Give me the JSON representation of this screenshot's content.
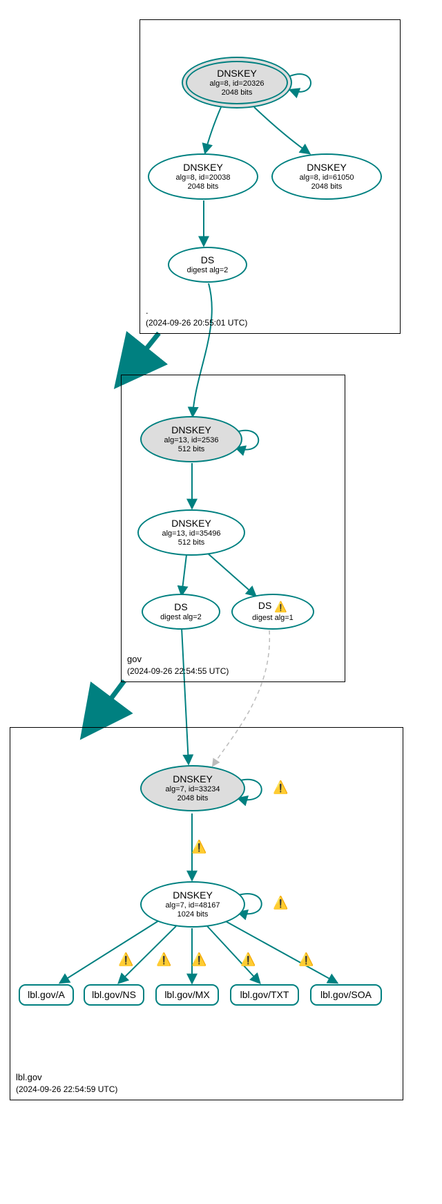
{
  "chart_data": {
    "type": "diagram",
    "diagram_type": "dnssec-chain-of-trust",
    "zones": [
      {
        "name": ".",
        "timestamp": "(2024-09-26 20:55:01 UTC)",
        "nodes": [
          {
            "id": "root-ksk",
            "kind": "DNSKEY",
            "alg": "alg=8, id=20326",
            "bits": "2048 bits",
            "shape": "ellipse",
            "grey": true,
            "double": true
          },
          {
            "id": "root-zsk",
            "kind": "DNSKEY",
            "alg": "alg=8, id=20038",
            "bits": "2048 bits",
            "shape": "ellipse",
            "grey": false,
            "double": false
          },
          {
            "id": "root-dnskey3",
            "kind": "DNSKEY",
            "alg": "alg=8, id=61050",
            "bits": "2048 bits",
            "shape": "ellipse",
            "grey": false,
            "double": false
          },
          {
            "id": "root-ds",
            "kind": "DS",
            "alg": "digest alg=2",
            "bits": "",
            "shape": "ellipse",
            "grey": false,
            "double": false
          }
        ],
        "edges": [
          {
            "from": "root-ksk",
            "to": "root-ksk",
            "self": true
          },
          {
            "from": "root-ksk",
            "to": "root-zsk"
          },
          {
            "from": "root-ksk",
            "to": "root-dnskey3"
          },
          {
            "from": "root-zsk",
            "to": "root-ds"
          }
        ]
      },
      {
        "name": "gov",
        "timestamp": "(2024-09-26 22:54:55 UTC)",
        "nodes": [
          {
            "id": "gov-ksk",
            "kind": "DNSKEY",
            "alg": "alg=13, id=2536",
            "bits": "512 bits",
            "shape": "ellipse",
            "grey": true,
            "double": false
          },
          {
            "id": "gov-zsk",
            "kind": "DNSKEY",
            "alg": "alg=13, id=35496",
            "bits": "512 bits",
            "shape": "ellipse",
            "grey": false,
            "double": false
          },
          {
            "id": "gov-ds2",
            "kind": "DS",
            "alg": "digest alg=2",
            "bits": "",
            "shape": "ellipse",
            "grey": false,
            "double": false,
            "warn": false
          },
          {
            "id": "gov-ds1",
            "kind": "DS",
            "alg": "digest alg=1",
            "bits": "",
            "shape": "ellipse",
            "grey": false,
            "double": false,
            "warn": true
          }
        ],
        "edges": [
          {
            "from": "root-ds",
            "to": "gov-ksk"
          },
          {
            "from": "gov-ksk",
            "to": "gov-ksk",
            "self": true
          },
          {
            "from": "gov-ksk",
            "to": "gov-zsk"
          },
          {
            "from": "gov-zsk",
            "to": "gov-ds2"
          },
          {
            "from": "gov-zsk",
            "to": "gov-ds1"
          }
        ]
      },
      {
        "name": "lbl.gov",
        "timestamp": "(2024-09-26 22:54:59 UTC)",
        "nodes": [
          {
            "id": "lbl-ksk",
            "kind": "DNSKEY",
            "alg": "alg=7, id=33234",
            "bits": "2048 bits",
            "shape": "ellipse",
            "grey": true,
            "double": false,
            "warn_self": true
          },
          {
            "id": "lbl-zsk",
            "kind": "DNSKEY",
            "alg": "alg=7, id=48167",
            "bits": "1024 bits",
            "shape": "ellipse",
            "grey": false,
            "double": false,
            "warn_self": true
          },
          {
            "id": "lbl-a",
            "kind": "RR",
            "label": "lbl.gov/A",
            "shape": "rrect"
          },
          {
            "id": "lbl-ns",
            "kind": "RR",
            "label": "lbl.gov/NS",
            "shape": "rrect"
          },
          {
            "id": "lbl-mx",
            "kind": "RR",
            "label": "lbl.gov/MX",
            "shape": "rrect"
          },
          {
            "id": "lbl-txt",
            "kind": "RR",
            "label": "lbl.gov/TXT",
            "shape": "rrect"
          },
          {
            "id": "lbl-soa",
            "kind": "RR",
            "label": "lbl.gov/SOA",
            "shape": "rrect"
          }
        ],
        "edges": [
          {
            "from": "gov-ds2",
            "to": "lbl-ksk",
            "style": "solid"
          },
          {
            "from": "gov-ds1",
            "to": "lbl-ksk",
            "style": "dashed"
          },
          {
            "from": "lbl-ksk",
            "to": "lbl-ksk",
            "self": true,
            "warn": true
          },
          {
            "from": "lbl-ksk",
            "to": "lbl-zsk",
            "warn": true
          },
          {
            "from": "lbl-zsk",
            "to": "lbl-zsk",
            "self": true,
            "warn": true
          },
          {
            "from": "lbl-zsk",
            "to": "lbl-a",
            "warn": true
          },
          {
            "from": "lbl-zsk",
            "to": "lbl-ns",
            "warn": true
          },
          {
            "from": "lbl-zsk",
            "to": "lbl-mx",
            "warn": true
          },
          {
            "from": "lbl-zsk",
            "to": "lbl-txt",
            "warn": true
          },
          {
            "from": "lbl-zsk",
            "to": "lbl-soa",
            "warn": true
          }
        ]
      }
    ]
  },
  "labels": {
    "dnskey": "DNSKEY",
    "ds": "DS"
  },
  "zone_root": {
    "name": ".",
    "ts": "(2024-09-26 20:55:01 UTC)"
  },
  "zone_gov": {
    "name": "gov",
    "ts": "(2024-09-26 22:54:55 UTC)"
  },
  "zone_lbl": {
    "name": "lbl.gov",
    "ts": "(2024-09-26 22:54:59 UTC)"
  },
  "nodes": {
    "root_ksk": {
      "l1": "DNSKEY",
      "l2": "alg=8, id=20326",
      "l3": "2048 bits"
    },
    "root_zsk": {
      "l1": "DNSKEY",
      "l2": "alg=8, id=20038",
      "l3": "2048 bits"
    },
    "root_k3": {
      "l1": "DNSKEY",
      "l2": "alg=8, id=61050",
      "l3": "2048 bits"
    },
    "root_ds": {
      "l1": "DS",
      "l2": "digest alg=2"
    },
    "gov_ksk": {
      "l1": "DNSKEY",
      "l2": "alg=13, id=2536",
      "l3": "512 bits"
    },
    "gov_zsk": {
      "l1": "DNSKEY",
      "l2": "alg=13, id=35496",
      "l3": "512 bits"
    },
    "gov_ds2": {
      "l1": "DS",
      "l2": "digest alg=2"
    },
    "gov_ds1": {
      "l1": "DS",
      "l2": "digest alg=1"
    },
    "lbl_ksk": {
      "l1": "DNSKEY",
      "l2": "alg=7, id=33234",
      "l3": "2048 bits"
    },
    "lbl_zsk": {
      "l1": "DNSKEY",
      "l2": "alg=7, id=48167",
      "l3": "1024 bits"
    },
    "lbl_a": {
      "l1": "lbl.gov/A"
    },
    "lbl_ns": {
      "l1": "lbl.gov/NS"
    },
    "lbl_mx": {
      "l1": "lbl.gov/MX"
    },
    "lbl_txt": {
      "l1": "lbl.gov/TXT"
    },
    "lbl_soa": {
      "l1": "lbl.gov/SOA"
    }
  }
}
